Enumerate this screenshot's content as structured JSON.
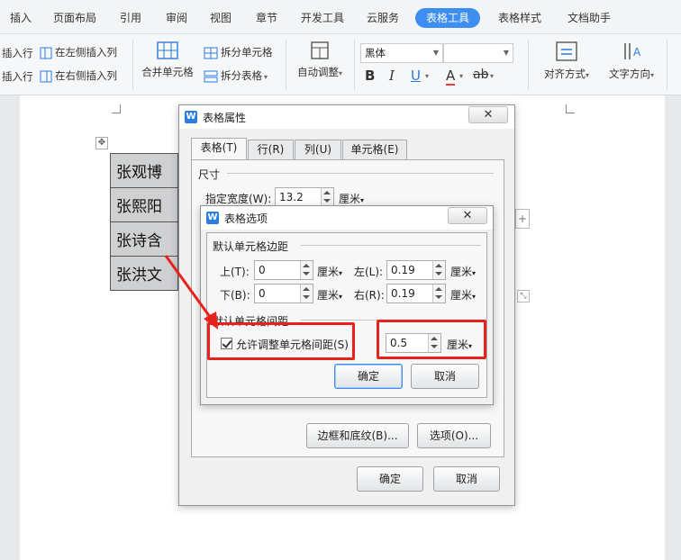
{
  "menu": {
    "items": [
      "插入",
      "页面布局",
      "引用",
      "审阅",
      "视图",
      "章节",
      "开发工具",
      "云服务",
      "表格工具",
      "表格样式",
      "文档助手"
    ],
    "active": "表格工具"
  },
  "ribbon": {
    "insert_row_above": "插入行",
    "insert_row_below": "插入行",
    "insert_left": "在左侧插入列",
    "insert_right": "在右侧插入列",
    "merge_cells": "合并单元格",
    "split_cells": "拆分单元格",
    "split_table": "拆分表格",
    "autofit": "自动调整",
    "font_name": "黑体",
    "font_size": "",
    "align": "对齐方式",
    "text_direction": "文字方向",
    "bold": "B",
    "italic": "I",
    "underline": "U",
    "font_color": "A",
    "highlight": "ab"
  },
  "table": {
    "rows": [
      "张观博",
      "张熙阳",
      "张诗含",
      "张洪文"
    ]
  },
  "props_dialog": {
    "title": "表格属性",
    "tabs": [
      "表格(T)",
      "行(R)",
      "列(U)",
      "单元格(E)"
    ],
    "size_group": "尺寸",
    "width_label": "指定宽度(W):",
    "width_value": "13.2",
    "width_unit": "厘米",
    "borders_button": "边框和底纹(B)...",
    "options_button": "选项(O)...",
    "ok": "确定",
    "cancel": "取消"
  },
  "options_dialog": {
    "title": "表格选项",
    "margins_group": "默认单元格边距",
    "top_label": "上(T):",
    "top_value": "0",
    "bottom_label": "下(B):",
    "bottom_value": "0",
    "left_label": "左(L):",
    "left_value": "0.19",
    "right_label": "右(R):",
    "right_value": "0.19",
    "unit": "厘米",
    "spacing_group": "默认单元格间距",
    "allow_spacing_label": "允许调整单元格间距(S)",
    "allow_spacing_checked": true,
    "spacing_value": "0.5",
    "ok": "确定",
    "cancel": "取消"
  },
  "colors": {
    "accent": "#3d8ef0",
    "highlight_box": "#e8211c"
  }
}
